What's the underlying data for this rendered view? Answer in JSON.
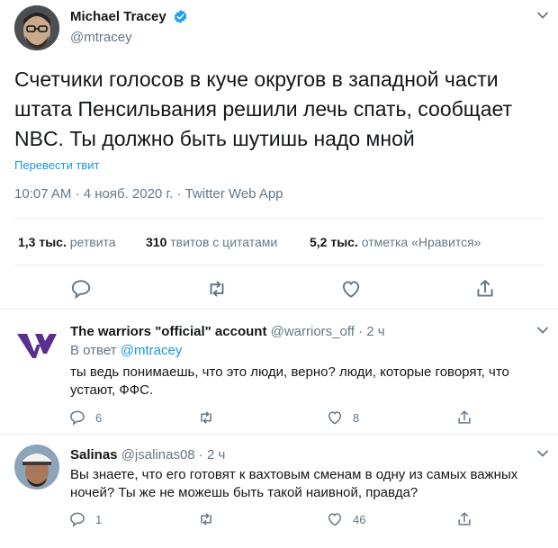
{
  "tweet": {
    "author_name": "Michael Tracey",
    "author_handle": "@mtracey",
    "text": "Счетчики голосов в куче округов в западной части штата Пенсильвания решили лечь спать, сообщает NBC. Ты должно быть шутишь надо мной",
    "translate_label": "Перевести твит",
    "meta": "10:07 AM · 4 нояб. 2020 г. · Twitter Web App",
    "stats": [
      {
        "count": "1,3 тыс.",
        "label": "ретвита"
      },
      {
        "count": "310",
        "label": "твитов с цитатами"
      },
      {
        "count": "5,2 тыс.",
        "label": "отметка «Нравится»"
      }
    ]
  },
  "replies": [
    {
      "name": "The warriors \"official\" account",
      "handle": "@warriors_off",
      "time": "· 2 ч",
      "reply_to_prefix": "В ответ",
      "reply_to": "@mtracey",
      "text": "ты ведь понимаешь, что это люди, верно? люди, которые говорят, что устают, ФФС.",
      "replies_count": "6",
      "likes_count": "8"
    },
    {
      "name": "Salinas",
      "handle": "@jsalinas08",
      "time": "· 2 ч",
      "text": "Вы знаете, что его готовят к вахтовым сменам в одну из самых важных ночей? Ты же не можешь быть такой наивной, правда?",
      "replies_count": "1",
      "likes_count": "46"
    }
  ],
  "colors": {
    "link": "#1b95e0",
    "muted": "#657786",
    "text": "#14171a",
    "divider": "#e6ecf0",
    "warriors_logo": "#5b2d8e"
  },
  "icons": [
    "verified-badge-icon",
    "chevron-down-icon",
    "reply-icon",
    "retweet-icon",
    "like-icon",
    "share-icon"
  ]
}
